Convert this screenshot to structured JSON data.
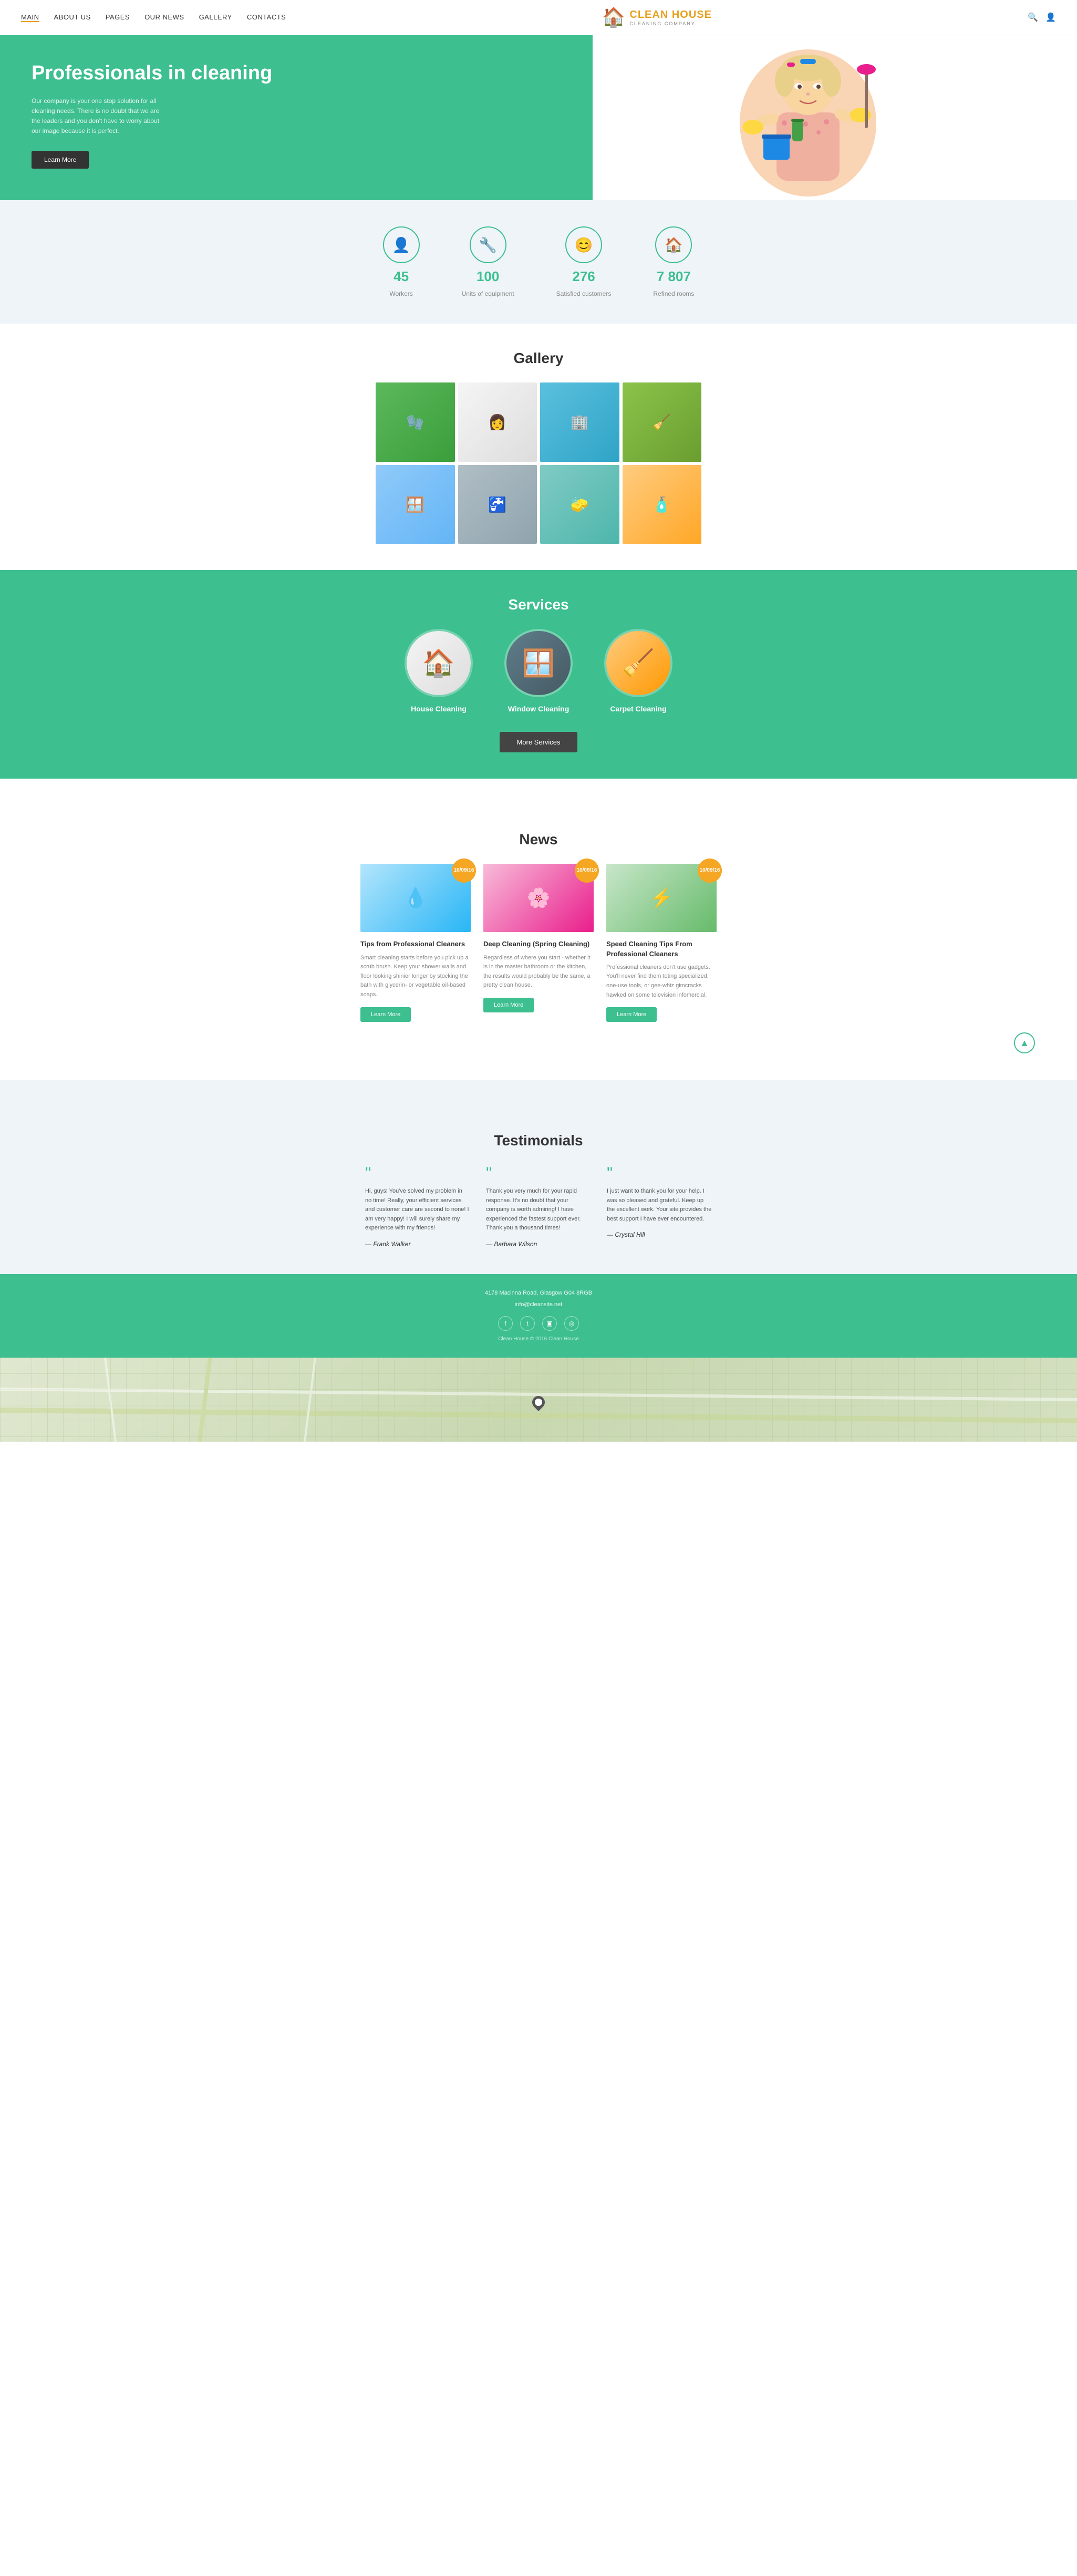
{
  "nav": {
    "links": [
      {
        "id": "main",
        "label": "MAIN",
        "active": true
      },
      {
        "id": "about-us",
        "label": "ABOUT US",
        "active": false
      },
      {
        "id": "pages",
        "label": "PAGES",
        "active": false
      },
      {
        "id": "our-news",
        "label": "OUR NEWS",
        "active": false
      },
      {
        "id": "gallery",
        "label": "GALLERY",
        "active": false
      },
      {
        "id": "contacts",
        "label": "CONTACTS",
        "active": false
      }
    ]
  },
  "logo": {
    "title": "CLEAN HOUSE",
    "subtitle": "CLEANING COMPANY"
  },
  "hero": {
    "headline": "Professionals in cleaning",
    "description": "Our company is your one stop solution for all cleaning needs. There is no doubt that we are the leaders and you don't have to worry about our image because it is perfect.",
    "button_label": "Learn More"
  },
  "stats": [
    {
      "icon": "👤",
      "number": "45",
      "label": "Workers"
    },
    {
      "icon": "🔧",
      "number": "100",
      "label": "Units of equipment"
    },
    {
      "icon": "😊",
      "number": "276",
      "label": "Satisfied customers"
    },
    {
      "icon": "🏠",
      "number": "7 807",
      "label": "Refined rooms"
    }
  ],
  "gallery": {
    "title": "Gallery",
    "images": [
      {
        "emoji": "🧤",
        "class": "gc1"
      },
      {
        "emoji": "👩",
        "class": "gc2"
      },
      {
        "emoji": "🏢",
        "class": "gc3"
      },
      {
        "emoji": "🧹",
        "class": "gc4"
      },
      {
        "emoji": "🪟",
        "class": "gc5"
      },
      {
        "emoji": "🚰",
        "class": "gc6"
      },
      {
        "emoji": "🧽",
        "class": "gc7"
      },
      {
        "emoji": "🧴",
        "class": "gc8"
      }
    ]
  },
  "services": {
    "title": "Services",
    "items": [
      {
        "label": "House Cleaning",
        "emoji": "🏠",
        "class": "sc1"
      },
      {
        "label": "Window Cleaning",
        "emoji": "🪟",
        "class": "sc2"
      },
      {
        "label": "Carpet Cleaning",
        "emoji": "🧹",
        "class": "sc3"
      }
    ],
    "more_button": "More Services"
  },
  "news": {
    "title": "News",
    "items": [
      {
        "date": "10/09/16",
        "title": "Tips from Professional Cleaners",
        "text": "Smart cleaning starts before you pick up a scrub brush. Keep your shower walls and floor looking shinier longer by stocking the bath with glycerin- or vegetable oil-based soaps.",
        "button": "Learn More",
        "img_class": "ni1",
        "emoji": "💧"
      },
      {
        "date": "10/09/16",
        "title": "Deep Cleaning (Spring Cleaning)",
        "text": "Regardless of where you start - whether it is in the master bathroom or the kitchen, the results would probably be the same, a pretty clean house.",
        "button": "Learn More",
        "img_class": "ni2",
        "emoji": "🌸"
      },
      {
        "date": "10/09/16",
        "title": "Speed Cleaning Tips From Professional Cleaners",
        "text": "Professional cleaners don't use gadgets. You'll never find them toting specialized, one-use tools, or gee-whiz gimcracks hawked on some television infomercial.",
        "button": "Learn More",
        "img_class": "ni3",
        "emoji": "⚡"
      }
    ]
  },
  "testimonials": {
    "title": "Testimonials",
    "items": [
      {
        "text": "Hi, guys! You've solved my problem in no time! Really, your efficient services and customer care are second to none! I am very happy! I will surely share my experience with my friends!",
        "author": "— Frank Walker"
      },
      {
        "text": "Thank you very much for your rapid response. It's no doubt that your company is worth admiring! I have experienced the fastest support ever. Thank you a thousand times!",
        "author": "— Barbara Wilson"
      },
      {
        "text": "I just want to thank you for your help. I was so pleased and grateful. Keep up the excellent work. Your site provides the best support I have ever encountered.",
        "author": "— Crystal Hill"
      }
    ]
  },
  "footer": {
    "address": "4178 Macinna Road, Glasgow G04 8RGB",
    "email": "info@cleansite.net",
    "copyright": "Clean House © 2016 Clean House"
  },
  "scroll_top": "▲"
}
